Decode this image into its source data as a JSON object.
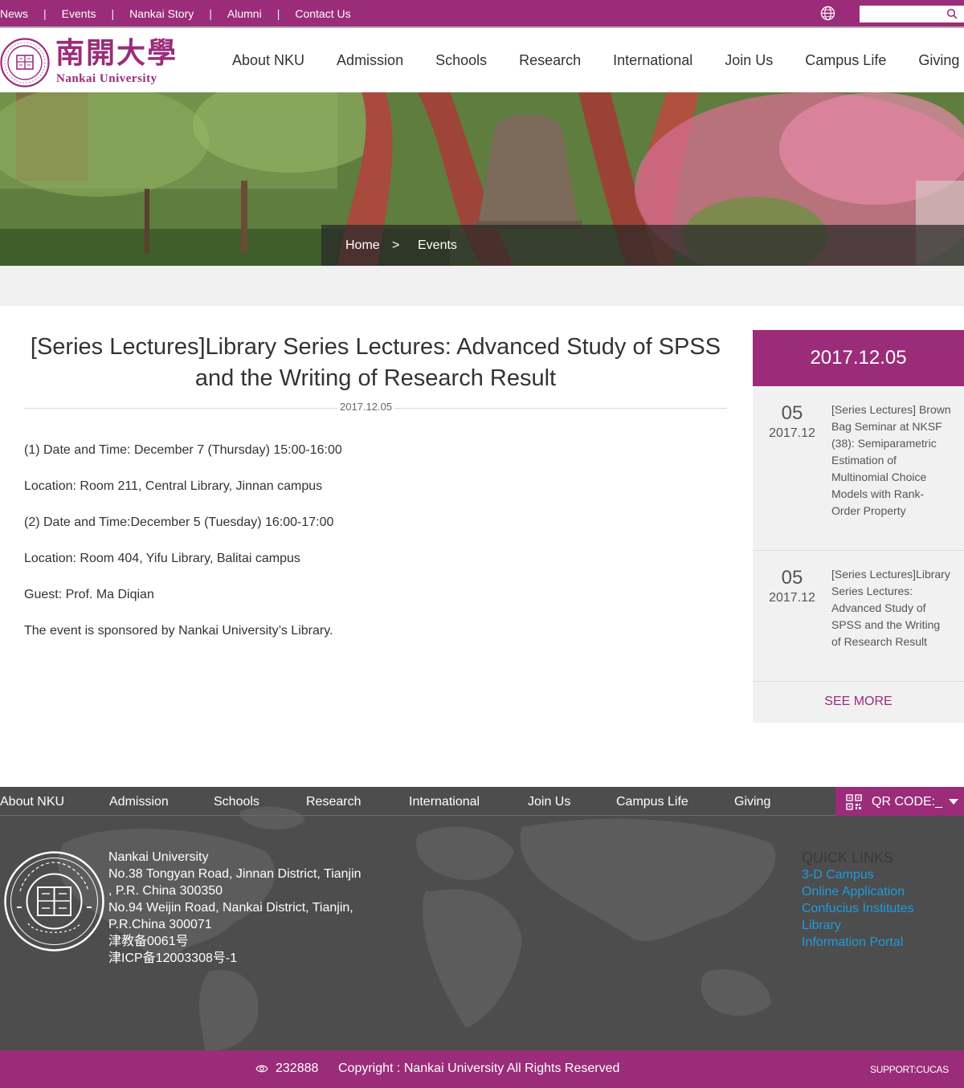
{
  "top_nav": {
    "items": [
      "News",
      "Events",
      "Nankai Story",
      "Alumni",
      "Contact Us"
    ],
    "separator": "|"
  },
  "search": {
    "placeholder": ""
  },
  "logo": {
    "cn": "南開大學",
    "en": "Nankai University"
  },
  "main_nav": [
    "About NKU",
    "Admission",
    "Schools",
    "Research",
    "International",
    "Join Us",
    "Campus Life",
    "Giving"
  ],
  "breadcrumb": {
    "home": "Home",
    "sep": ">",
    "current": "Events"
  },
  "article": {
    "title": "[Series Lectures]Library Series Lectures: Advanced Study of SPSS and the Writing of Research Result",
    "date": "2017.12.05",
    "paragraphs": [
      "(1) Date and Time: December 7 (Thursday) 15:00-16:00",
      "Location: Room 211, Central Library, Jinnan campus",
      "(2) Date and Time:December 5 (Tuesday) 16:00-17:00",
      "Location: Room 404, Yifu Library, Balitai campus",
      "Guest: Prof. Ma Diqian",
      "The event is sponsored by Nankai University’s Library."
    ]
  },
  "sidebar": {
    "date": "2017.12.05",
    "items": [
      {
        "day": "05",
        "ym": "2017.12",
        "text": "[Series Lectures] Brown Bag Seminar at NKSF (38): Semiparametric Estimation of Multinomial Choice Models with Rank-Order Property"
      },
      {
        "day": "05",
        "ym": "2017.12",
        "text": "[Series Lectures]Library Series Lectures: Advanced Study of SPSS and the Writing of Research Result"
      }
    ],
    "see_more": "SEE MORE"
  },
  "footer": {
    "nav": [
      "About NKU",
      "Admission",
      "Schools",
      "Research",
      "International",
      "Join Us",
      "Campus Life",
      "Giving"
    ],
    "qr_label": "QR CODE:_",
    "address": [
      "Nankai University",
      "No.38 Tongyan Road, Jinnan District, Tianjin",
      ", P.R. China 300350",
      "No.94 Weijin Road,  Nankai District, Tianjin,",
      "P.R.China  300071",
      "津教备0061号",
      "津ICP备12003308号-1"
    ],
    "quick_links_title": "QUICK LINKS",
    "quick_links": [
      "3-D Campus",
      "Online Application",
      "Confucius Institutes",
      "Library",
      "Information Portal"
    ],
    "visit_count": "232888",
    "copyright": "Copyright : Nankai University All Rights Reserved",
    "support": "SUPPORT:CUCAS"
  },
  "colors": {
    "brand": "#9b2c79",
    "link": "#1e9be0",
    "footer_bg": "#4d4d4d"
  }
}
